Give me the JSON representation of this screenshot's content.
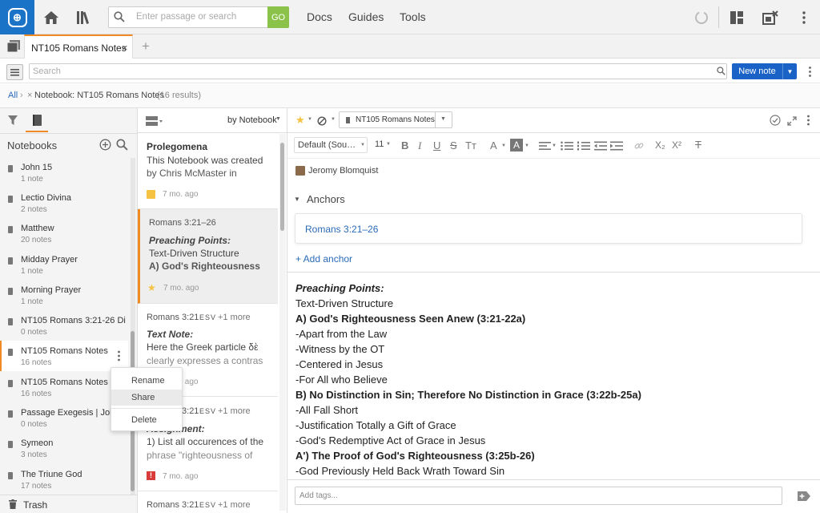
{
  "topbar": {
    "search_placeholder": "Enter passage or search",
    "go_label": "GO",
    "nav": [
      "Docs",
      "Guides",
      "Tools"
    ]
  },
  "tabs": {
    "active_title": "NT105 Romans Notes",
    "close_glyph": "×",
    "add_glyph": "+"
  },
  "search": {
    "placeholder": "Search",
    "new_note_label": "New note"
  },
  "breadcrumb": {
    "all": "All",
    "sep": "›",
    "filter_x": "×",
    "filter_label": "Notebook: NT105 Romans Notes",
    "results": "(16 results)"
  },
  "notebooks": {
    "title": "Notebooks",
    "items": [
      {
        "name": "John 15",
        "count": "1 note"
      },
      {
        "name": "Lectio Divina",
        "count": "2 notes"
      },
      {
        "name": "Matthew",
        "count": "20 notes"
      },
      {
        "name": "Midday Prayer",
        "count": "1 note"
      },
      {
        "name": "Morning Prayer",
        "count": "1 note"
      },
      {
        "name": "NT105 Romans 3:21-26 Di…",
        "count": "0 notes"
      },
      {
        "name": "NT105 Romans Notes",
        "count": "16 notes"
      },
      {
        "name": "NT105 Romans Notes (Tr",
        "count": "16 notes"
      },
      {
        "name": "Passage Exegesis | John",
        "count": "0 notes"
      },
      {
        "name": "Symeon",
        "count": "3 notes"
      },
      {
        "name": "The Triune God",
        "count": "17 notes"
      }
    ],
    "trash_label": "Trash"
  },
  "context_menu": {
    "items": [
      "Rename",
      "Share",
      "Delete"
    ]
  },
  "notelist": {
    "sort_label": "by Notebook",
    "cards": [
      {
        "heading": "Prolegomena",
        "lines": [
          "This Notebook was created",
          "by Chris McMaster in"
        ],
        "time": "7 mo. ago"
      },
      {
        "reference": "Romans 3:21–26",
        "lines": [
          "Preaching Points:",
          "Text-Driven Structure",
          "A) God's Righteousness"
        ],
        "time": "7 mo. ago"
      },
      {
        "reference": "Romans 3:21",
        "version": "ESV",
        "more": "+1 more",
        "lines": [
          "Text Note:",
          "Here the Greek particle δὲ",
          "clearly expresses a contras"
        ],
        "time": "7 mo. ago"
      },
      {
        "reference": "Romans 3:21",
        "version": "ESV",
        "more": "+1 more",
        "lines": [
          "Assignment:",
          "1) List all occurences of the",
          "phrase \"righteousness of"
        ],
        "time": "7 mo. ago"
      },
      {
        "reference": "Romans 3:21",
        "version": "ESV",
        "more": "+1 more"
      }
    ]
  },
  "editor": {
    "notebook_chip": "NT105 Romans Notes",
    "font_label": "Default (Sou…",
    "size_label": "11",
    "author": "Jeromy Blomquist",
    "anchors_heading": "Anchors",
    "anchor_ref": "Romans 3:21–26",
    "add_anchor": "+ Add anchor",
    "body": [
      "Preaching Points:",
      "Text-Driven Structure",
      "A) God's Righteousness Seen Anew (3:21-22a)",
      "-Apart from the Law",
      "-Witness by the OT",
      "-Centered in Jesus",
      "-For All who Believe",
      "B) No Distinction in Sin; Therefore No Distinction in Grace (3:22b-25a)",
      "-All Fall Short",
      "-Justification Totally a Gift of Grace",
      "-God's Redemptive Act of Grace in Jesus",
      "A') The Proof of God's Righteousness (3:25b-26)",
      "-God Previously Held Back Wrath Toward Sin"
    ],
    "tags_placeholder": "Add tags..."
  },
  "colors": {
    "brand_blue": "#1a73c6",
    "go_green": "#8bc34a",
    "accent_orange": "#f08a24",
    "link_blue": "#2a6ab8",
    "star_yellow": "#f5c242",
    "alert_red": "#d93b3b"
  }
}
